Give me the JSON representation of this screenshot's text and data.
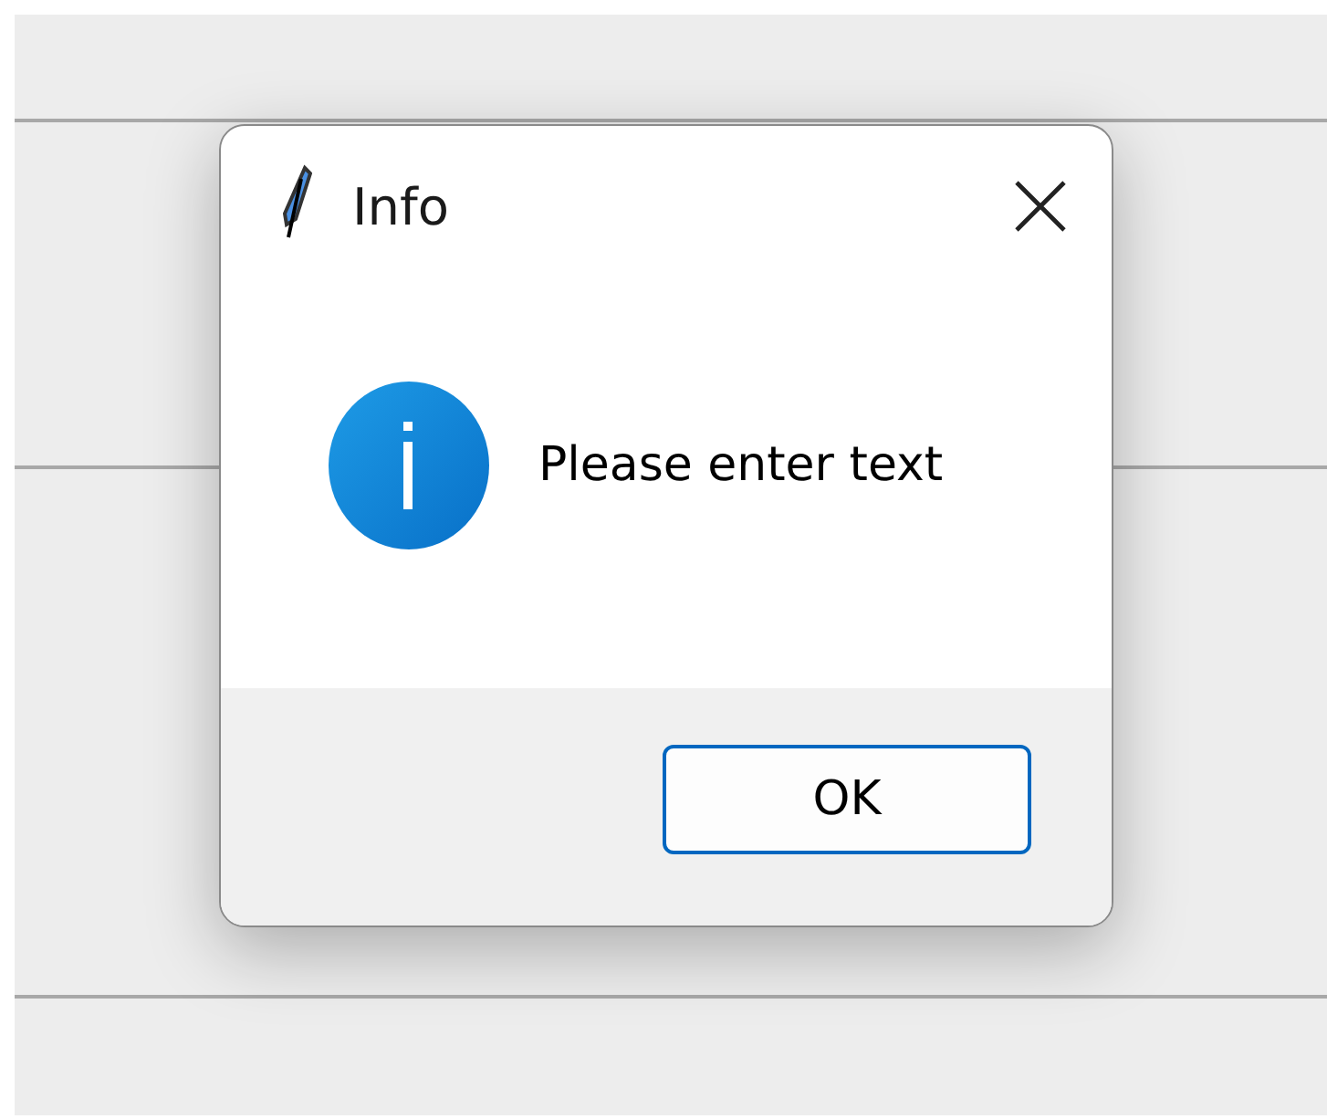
{
  "window": {
    "title": "Info"
  },
  "message": "Please enter text",
  "buttons": [
    {
      "label": "OK",
      "focused": true
    }
  ]
}
